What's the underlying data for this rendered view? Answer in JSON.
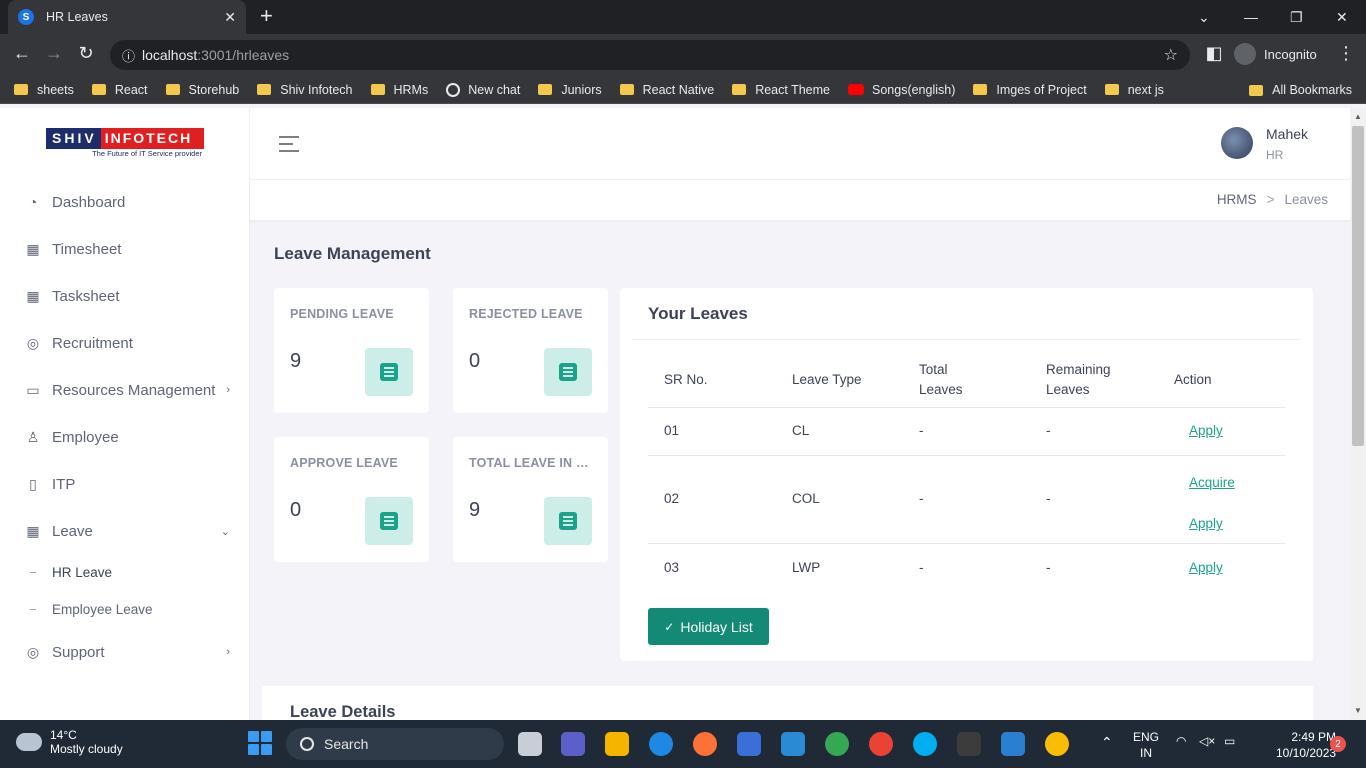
{
  "browser": {
    "tab_title": "HR Leaves",
    "tab_favicon_letter": "S",
    "url_host": "localhost",
    "url_path": ":3001/hrleaves",
    "profile_label": "Incognito",
    "bookmarks": [
      "sheets",
      "React",
      "Storehub",
      "Shiv Infotech",
      "HRMs",
      "New chat",
      "Juniors",
      "React Native",
      "React Theme",
      "Songs(english)",
      "Imges of Project",
      "next js"
    ],
    "all_bookmarks": "All Bookmarks"
  },
  "logo": {
    "part1": "SHIV",
    "part2": "INFOTECH",
    "tagline": "The Future of IT Service provider"
  },
  "sidebar": {
    "items": [
      {
        "label": "Dashboard"
      },
      {
        "label": "Timesheet"
      },
      {
        "label": "Tasksheet"
      },
      {
        "label": "Recruitment"
      },
      {
        "label": "Resources Management"
      },
      {
        "label": "Employee"
      },
      {
        "label": "ITP"
      },
      {
        "label": "Leave"
      },
      {
        "label": "Support"
      }
    ],
    "subitems": [
      {
        "label": "HR Leave"
      },
      {
        "label": "Employee Leave"
      }
    ]
  },
  "header": {
    "user_name": "Mahek",
    "user_role": "HR"
  },
  "breadcrumb": {
    "root": "HRMS",
    "sep": ">",
    "current": "Leaves"
  },
  "page": {
    "title": "Leave Management"
  },
  "stats": [
    {
      "label": "PENDING LEAVE",
      "value": "9"
    },
    {
      "label": "REJECTED LEAVE",
      "value": "0"
    },
    {
      "label": "APPROVE LEAVE",
      "value": "0"
    },
    {
      "label": "TOTAL LEAVE IN B...",
      "value": "9"
    }
  ],
  "your_leaves": {
    "title": "Your Leaves",
    "headers": {
      "sr": "SR No.",
      "type": "Leave Type",
      "total_1": "Total",
      "total_2": "Leaves",
      "remaining_1": "Remaining",
      "remaining_2": "Leaves",
      "action": "Action"
    },
    "rows": [
      {
        "sr": "01",
        "type": "CL",
        "total": "-",
        "remaining": "-",
        "action_1": "Apply"
      },
      {
        "sr": "02",
        "type": "COL",
        "total": "-",
        "remaining": "-",
        "action_1": "Acquire",
        "action_2": "Apply"
      },
      {
        "sr": "03",
        "type": "LWP",
        "total": "-",
        "remaining": "-",
        "action_1": "Apply"
      }
    ],
    "holiday_button": "Holiday List",
    "holiday_check": "✓"
  },
  "details": {
    "title": "Leave Details"
  },
  "taskbar": {
    "temp": "14°C",
    "weather": "Mostly cloudy",
    "search": "Search",
    "lang_1": "ENG",
    "lang_2": "IN",
    "time": "2:49 PM",
    "date": "10/10/2023",
    "notifications": "2"
  },
  "colors": {
    "accent": "#1aa38a",
    "accent_dark": "#128a75",
    "accent_light": "#cdeee8",
    "logo_blue": "#1d2d6b",
    "logo_red": "#e02020"
  }
}
